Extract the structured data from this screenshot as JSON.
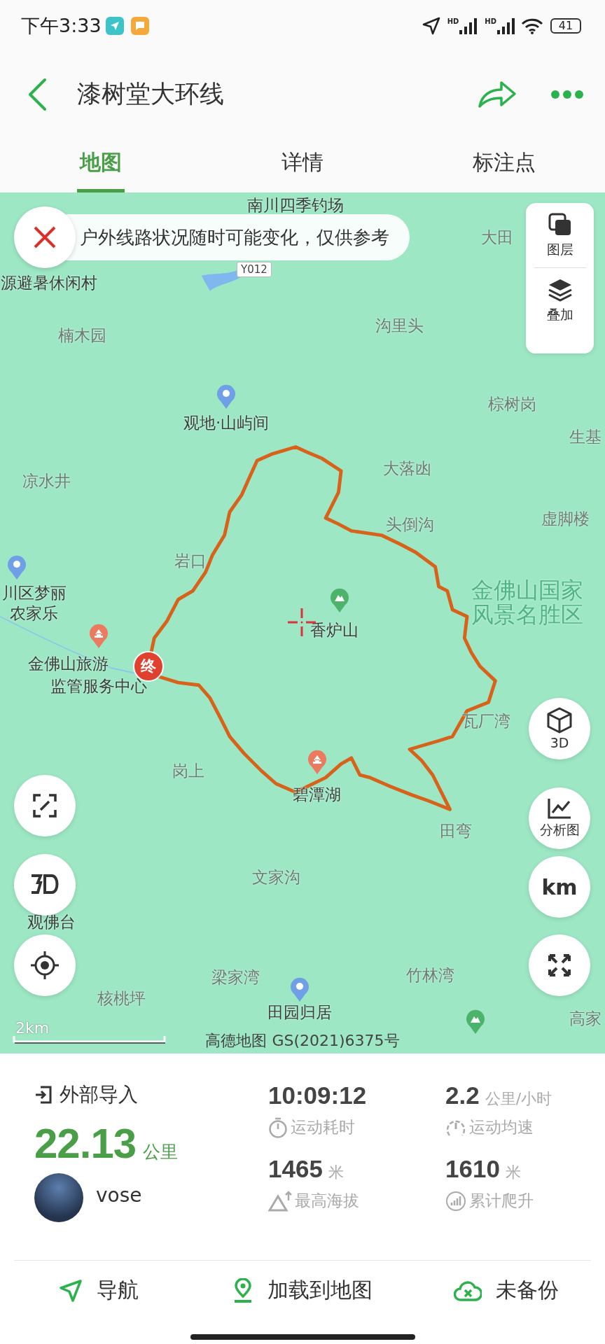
{
  "status_bar": {
    "time": "下午3:33",
    "network_labels": [
      "HD",
      "HD"
    ],
    "battery": "41"
  },
  "header": {
    "title": "漆树堂大环线"
  },
  "tabs": [
    {
      "label": "地图",
      "selected": true
    },
    {
      "label": "详情",
      "selected": false
    },
    {
      "label": "标注点",
      "selected": false
    }
  ],
  "map": {
    "notice": "户外线路状况随时可能变化，仅供参考",
    "road_badge": "Y012",
    "labels": [
      {
        "text": "南川四季钓场",
        "kind": "poi"
      },
      {
        "text": "源避暑休闲村",
        "kind": "poi"
      },
      {
        "text": "楠木园",
        "kind": "place"
      },
      {
        "text": "沟里头",
        "kind": "place"
      },
      {
        "text": "大田",
        "kind": "place"
      },
      {
        "text": "棕树岗",
        "kind": "place"
      },
      {
        "text": "生基",
        "kind": "place"
      },
      {
        "text": "观地·山屿间",
        "kind": "poi"
      },
      {
        "text": "凉水井",
        "kind": "place"
      },
      {
        "text": "大落凼",
        "kind": "place"
      },
      {
        "text": "头倒沟",
        "kind": "place"
      },
      {
        "text": "虚脚楼",
        "kind": "place"
      },
      {
        "text": "岩口",
        "kind": "place"
      },
      {
        "text": "川区梦丽农家乐",
        "kind": "poi"
      },
      {
        "text": "金佛山国家风景名胜区",
        "kind": "area"
      },
      {
        "text": "香炉山",
        "kind": "poi"
      },
      {
        "text": "金佛山旅游",
        "kind": "poi"
      },
      {
        "text": "监管服务中心",
        "kind": "poi"
      },
      {
        "text": "岗上",
        "kind": "place"
      },
      {
        "text": "碧潭湖",
        "kind": "poi"
      },
      {
        "text": "瓦厂湾",
        "kind": "place"
      },
      {
        "text": "田弯",
        "kind": "place"
      },
      {
        "text": "文家沟",
        "kind": "place"
      },
      {
        "text": "观佛台",
        "kind": "poi"
      },
      {
        "text": "梁家湾",
        "kind": "place"
      },
      {
        "text": "核桃坪",
        "kind": "place"
      },
      {
        "text": "竹林湾",
        "kind": "place"
      },
      {
        "text": "田园归居",
        "kind": "poi"
      },
      {
        "text": "高家",
        "kind": "place"
      }
    ],
    "pins": [
      {
        "kind": "spot"
      },
      {
        "kind": "spot"
      },
      {
        "kind": "scenic"
      },
      {
        "kind": "peak"
      },
      {
        "kind": "scenic"
      },
      {
        "kind": "spot"
      },
      {
        "kind": "peak"
      }
    ],
    "end_marker": "终",
    "scale": "2km",
    "copyright": "高德地图 GS(2021)6375号",
    "layer_buttons": [
      "图层",
      "叠加"
    ],
    "right_buttons": [
      {
        "kind": "cube",
        "label": "3D"
      },
      {
        "kind": "chart",
        "label": "分析图"
      },
      {
        "kind": "text",
        "label": "km"
      },
      {
        "kind": "expand"
      }
    ],
    "left_buttons": [
      {
        "kind": "fit"
      },
      {
        "kind": "terrain"
      },
      {
        "kind": "locate"
      }
    ]
  },
  "stats": {
    "source": "外部导入",
    "distance": "22.13",
    "distance_unit": "公里",
    "user": "vose",
    "metrics": [
      {
        "kind": "time",
        "value": "10:09:12",
        "label": "运动耗时"
      },
      {
        "kind": "speed",
        "value": "2.2",
        "unit": "公里/小时",
        "label": "运动均速"
      },
      {
        "kind": "altitude",
        "value": "1465",
        "unit": "米",
        "label": "最高海拔"
      },
      {
        "kind": "climb",
        "value": "1610",
        "unit": "米",
        "label": "累计爬升"
      }
    ]
  },
  "actions": [
    {
      "kind": "navigate",
      "label": "导航"
    },
    {
      "kind": "load",
      "label": "加载到地图"
    },
    {
      "kind": "backup",
      "label": "未备份"
    }
  ]
}
